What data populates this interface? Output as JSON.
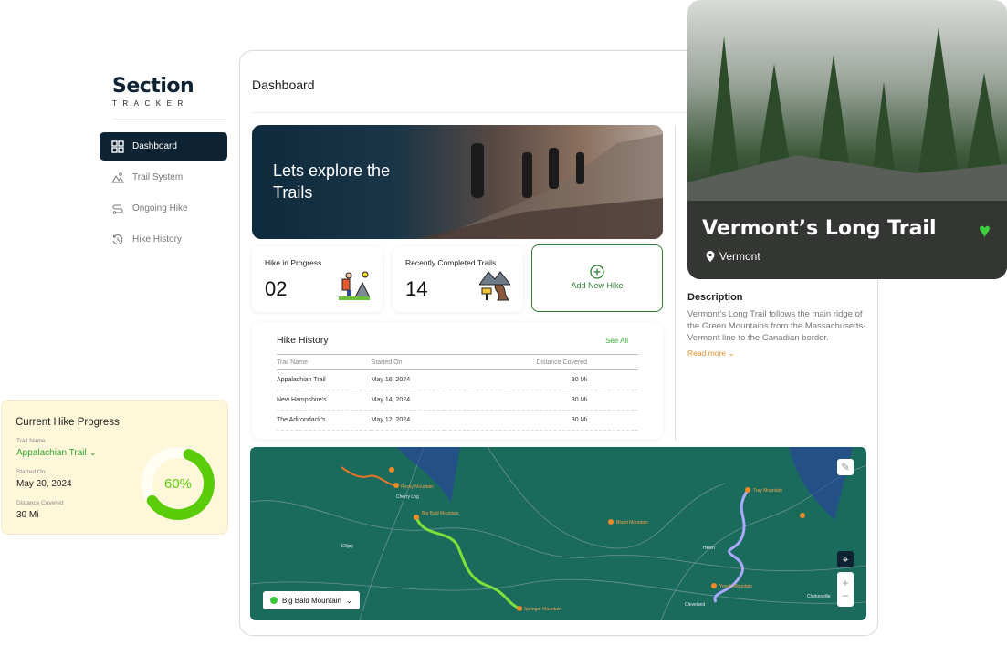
{
  "brand": {
    "name": "Section",
    "sub": "TRACKER"
  },
  "sidebar": {
    "items": [
      {
        "label": "Dashboard",
        "icon": "grid-icon",
        "active": true
      },
      {
        "label": "Trail System",
        "icon": "mountains-icon"
      },
      {
        "label": "Ongoing Hike",
        "icon": "route-icon"
      },
      {
        "label": "Hike History",
        "icon": "history-icon"
      }
    ]
  },
  "header": {
    "title": "Dashboard"
  },
  "hero": {
    "text": "Lets explore the Trails"
  },
  "stats": [
    {
      "label": "Hike in Progress",
      "value": "02",
      "icon": "hiker-icon"
    },
    {
      "label": "Recently Completed Trails",
      "value": "14",
      "icon": "trail-sign-icon"
    }
  ],
  "add_hike": {
    "label": "Add New Hike",
    "icon": "plus-circle-icon"
  },
  "history": {
    "title": "Hike History",
    "see_all": "See All",
    "columns": [
      "Trail Name",
      "Started On",
      "Distance Covered"
    ],
    "rows": [
      [
        "Appalachian Trail",
        "May 16, 2024",
        "30 Mi"
      ],
      [
        "New Hampshire's",
        "May 14, 2024",
        "30 Mi"
      ],
      [
        "The Adirondack's",
        "May 12, 2024",
        "30 Mi"
      ]
    ]
  },
  "map": {
    "selected": "Big Bald Mountain",
    "labels": [
      "Cherry Log",
      "Big Bald Mountain",
      "Springer Mountain",
      "Rocky Mountain",
      "Blood Mountain",
      "Tray Mountain",
      "Yonah Mountain",
      "Helen",
      "Cleveland",
      "Clarkesville",
      "Ellijay"
    ],
    "zoom_in": "+",
    "zoom_out": "−",
    "route_colors": [
      "#e8752a",
      "#7ee03a",
      "#6a6cf0"
    ]
  },
  "featured": {
    "name": "Vermont’s Long Trail",
    "location": "Vermont",
    "favorite": true,
    "heart_color": "#3ecf3e",
    "description_title": "Description",
    "description": "Vermont’s Long Trail follows the main ridge of the Green Mountains from the Massachusetts-Vermont line to the Canadian border.",
    "read_more": "Read more"
  },
  "progress": {
    "title": "Current Hike Progress",
    "trail_label": "Trail Name",
    "trail": "Appalachian Trail",
    "started_label": "Started On",
    "started": "May 20, 2024",
    "distance_label": "Distance Covered",
    "distance": "30 Mi",
    "percent": 60,
    "percent_text": "60%",
    "color": "#5acc0a"
  }
}
